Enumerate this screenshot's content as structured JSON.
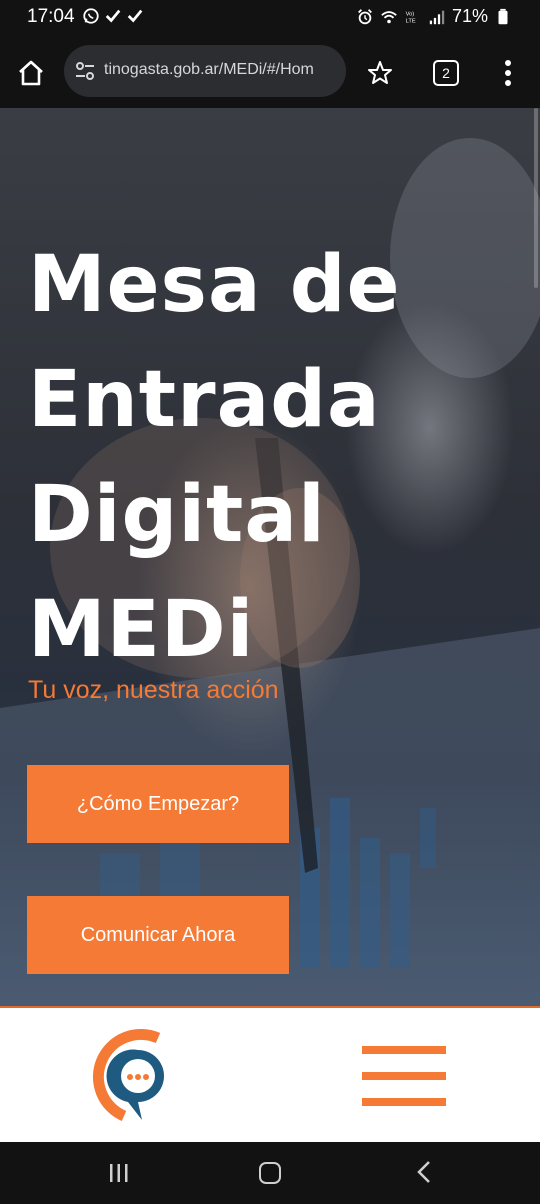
{
  "status_bar": {
    "time": "17:04",
    "battery": "71%"
  },
  "browser": {
    "url": "tinogasta.gob.ar/MEDi/#/Hom",
    "tab_count": "2"
  },
  "hero": {
    "title_lines": [
      "Mesa de",
      "Entrada",
      "Digital",
      "MEDi"
    ],
    "subtitle": "Tu voz, nuestra acción",
    "cta_start": "¿Cómo Empezar?",
    "cta_communicate": "Comunicar Ahora"
  },
  "colors": {
    "accent": "#f47a35",
    "logo_blue": "#1f5a80",
    "dark_bar": "#121212"
  },
  "icons": {
    "status": [
      "whatsapp-icon",
      "check-icon",
      "check-icon",
      "alarm-icon",
      "wifi-icon",
      "volte-icon",
      "signal-icon",
      "battery-icon"
    ],
    "browser": [
      "home-icon",
      "site-settings-icon",
      "bookmark-star-icon",
      "tabs-icon",
      "more-vert-icon"
    ],
    "android": [
      "recents-icon",
      "home-icon",
      "back-icon"
    ]
  }
}
